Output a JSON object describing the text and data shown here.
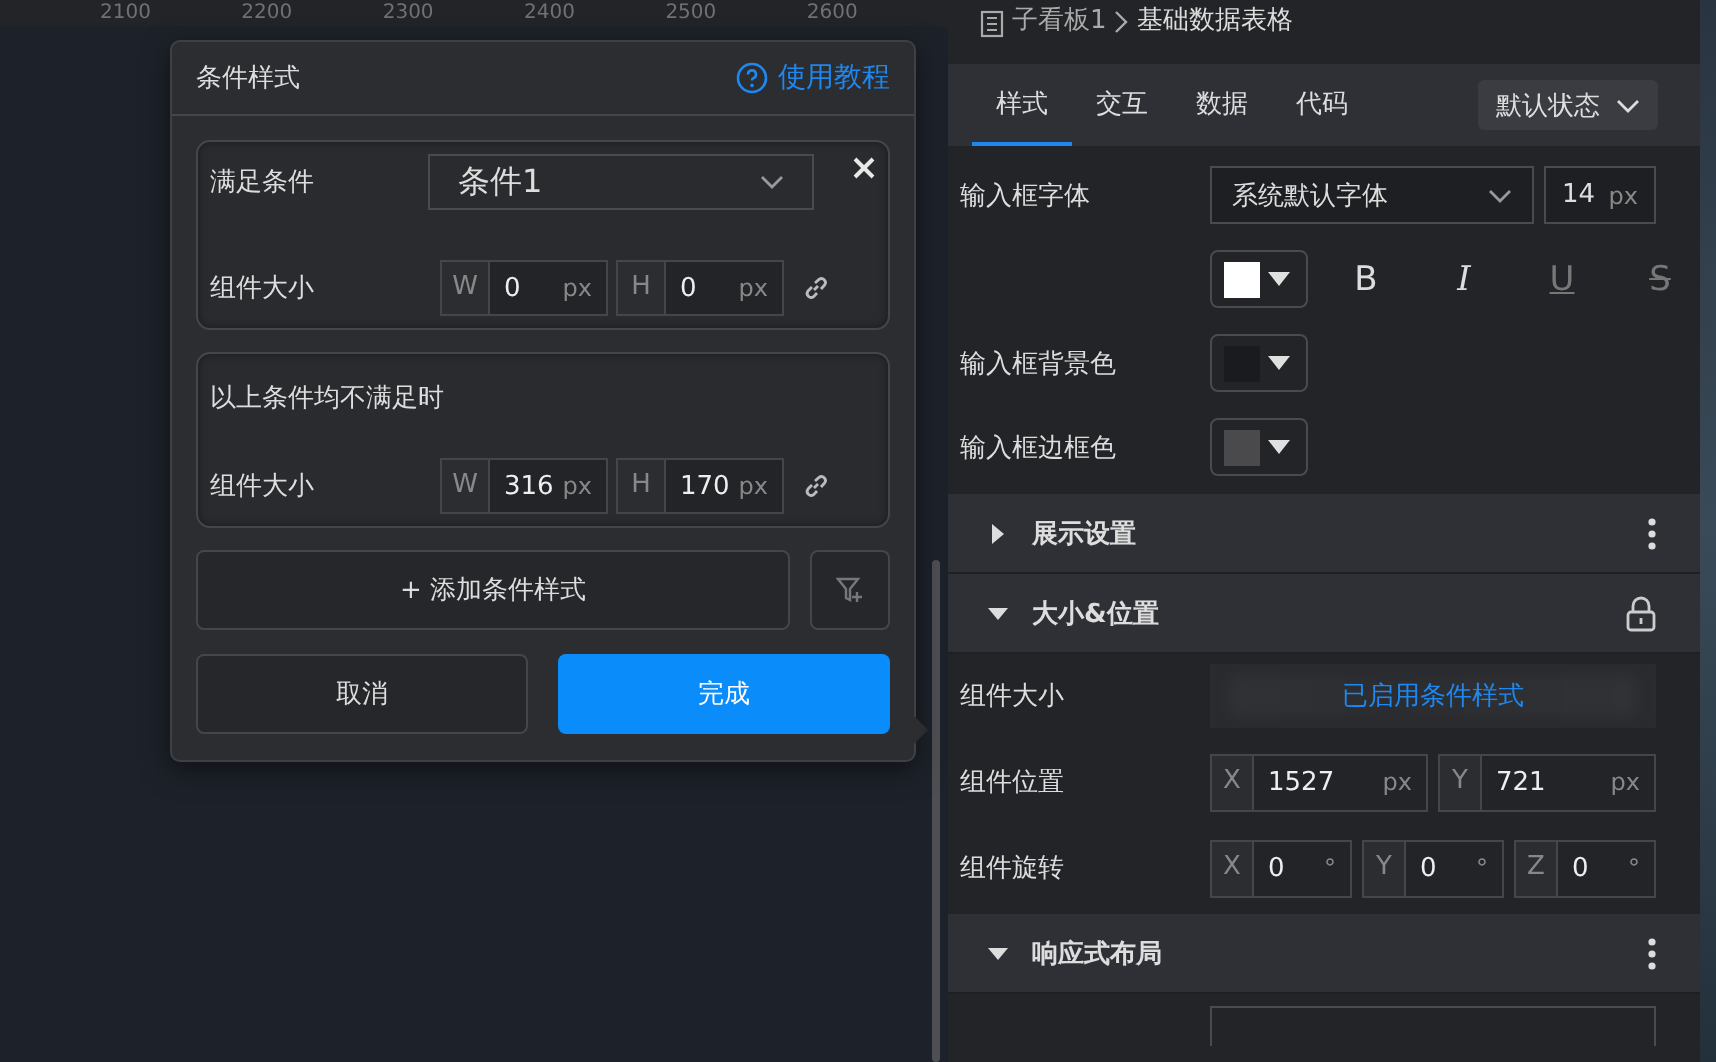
{
  "ruler": {
    "labels": [
      "2100",
      "2200",
      "2300",
      "2400",
      "2500",
      "2600"
    ]
  },
  "dialog": {
    "title": "条件样式",
    "help_link": "使用教程",
    "conditions": [
      {
        "label": "满足条件",
        "select": "条件1",
        "size_label": "组件大小",
        "fields": [
          {
            "prefix": "W",
            "value": "0",
            "unit": "px"
          },
          {
            "prefix": "H",
            "value": "0",
            "unit": "px"
          }
        ]
      }
    ],
    "fallback": {
      "title": "以上条件均不满足时",
      "size_label": "组件大小",
      "fields": [
        {
          "prefix": "W",
          "value": "316",
          "unit": "px"
        },
        {
          "prefix": "H",
          "value": "170",
          "unit": "px"
        }
      ]
    },
    "add_button": "+ 添加条件样式",
    "cancel_button": "取消",
    "confirm_button": "完成"
  },
  "panel": {
    "breadcrumb": [
      "子看板1",
      "基础数据表格"
    ],
    "tabs": [
      {
        "label": "样式",
        "selected": true
      },
      {
        "label": "交互",
        "selected": false
      },
      {
        "label": "数据",
        "selected": false
      },
      {
        "label": "代码",
        "selected": false
      }
    ],
    "state_dropdown": "默认状态",
    "style_rows": [
      {
        "kind": "font",
        "label": "输入框字体",
        "select": "系统默认字体",
        "size": {
          "value": "14",
          "unit": "px"
        }
      },
      {
        "kind": "format",
        "color": "#ffffff",
        "buttons": [
          {
            "label": "B",
            "disabled": false
          },
          {
            "label": "I",
            "disabled": false
          },
          {
            "label": "U",
            "disabled": true
          },
          {
            "label": "S",
            "disabled": true
          }
        ]
      },
      {
        "kind": "color",
        "label": "输入框背景色",
        "color": "#1a1b1e"
      },
      {
        "kind": "color",
        "label": "输入框边框色",
        "color": "#4a4a4d"
      }
    ],
    "sections": [
      {
        "title": "展示设置",
        "expanded": false,
        "kind": "menu"
      },
      {
        "title": "大小&位置",
        "expanded": true,
        "kind": "lock",
        "rows": [
          {
            "kind": "notice",
            "label": "组件大小",
            "notice": "已启用条件样式"
          },
          {
            "kind": "fields",
            "label": "组件位置",
            "fields": [
              {
                "prefix": "X",
                "value": "1527",
                "unit": "px"
              },
              {
                "prefix": "Y",
                "value": "721",
                "unit": "px"
              }
            ]
          },
          {
            "kind": "fields",
            "label": "组件旋转",
            "fields": [
              {
                "prefix": "X",
                "value": "0",
                "unit": "°"
              },
              {
                "prefix": "Y",
                "value": "0",
                "unit": "°"
              },
              {
                "prefix": "Z",
                "value": "0",
                "unit": "°"
              }
            ]
          }
        ]
      },
      {
        "title": "响应式布局",
        "expanded": true,
        "kind": "menu",
        "rows": [
          {
            "kind": "partial"
          }
        ]
      }
    ]
  }
}
